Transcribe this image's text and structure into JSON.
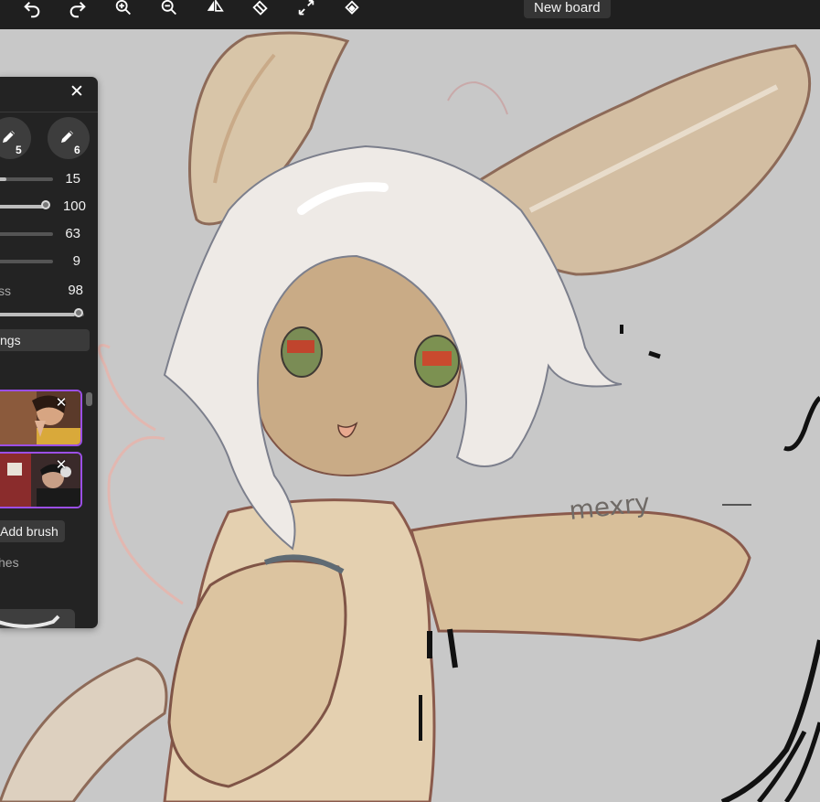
{
  "toolbar": {
    "buttons": [
      {
        "name": "undo-icon"
      },
      {
        "name": "redo-icon"
      },
      {
        "name": "zoom-in-icon"
      },
      {
        "name": "zoom-out-icon"
      },
      {
        "name": "flip-icon"
      },
      {
        "name": "eraser-icon"
      },
      {
        "name": "fullscreen-icon"
      },
      {
        "name": "fill-icon"
      }
    ],
    "new_board_label": "New board"
  },
  "brush_panel": {
    "close_glyph": "✕",
    "brush_slots": [
      {
        "number": "5",
        "icon": "pencil-icon"
      },
      {
        "number": "6",
        "icon": "pencil-icon"
      }
    ],
    "sliders": [
      {
        "value": "15",
        "level": 0.15
      },
      {
        "value": "100",
        "level": 1.0
      },
      {
        "value": "63",
        "level": 0.63
      },
      {
        "value": "9",
        "level": 0.09
      }
    ],
    "smoothness": {
      "label": "ss",
      "value": "98",
      "level": 0.98
    },
    "settings_label": "ngs",
    "textures": [
      {
        "remove_glyph": "✕"
      },
      {
        "remove_glyph": "✕"
      }
    ],
    "add_brush_label": "Add brush",
    "brushes_label": "hes"
  },
  "canvas": {
    "signature_text": "mexry",
    "colors": {
      "background": "#c8c8c8",
      "skin": "#dcc6a4",
      "line": "#8a5a4c",
      "hair": "#f1ebe6"
    }
  },
  "colors": {
    "toolbar_bg": "#1f1f1f",
    "panel_bg": "#232323",
    "accent": "#9b4fe6"
  }
}
